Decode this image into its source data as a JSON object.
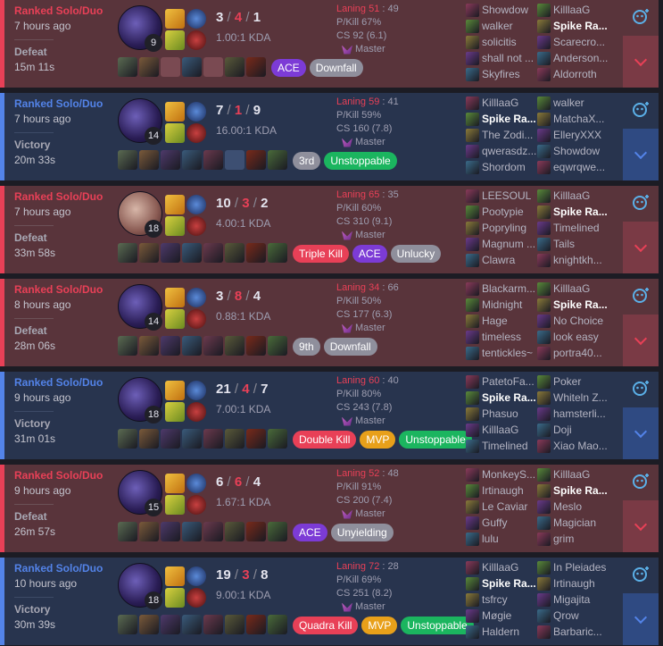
{
  "matches": [
    {
      "mode": "Ranked Solo/Duo",
      "ago": "7 hours ago",
      "result": "Defeat",
      "duration": "15m 11s",
      "outcome": "loss",
      "champ_level": "9",
      "champ_style": "kassadin",
      "k": "3",
      "d": "4",
      "a": "1",
      "kda_ratio": "1.00:1 KDA",
      "laning": "Laning 51",
      "laning_opp": "49",
      "pkill": "P/Kill 67%",
      "cs": "CS 92 (6.1)",
      "mastery": "Master",
      "items": [
        "filled",
        "filled",
        "empty",
        "filled",
        "empty",
        "filled",
        "filled"
      ],
      "badges": [
        {
          "label": "ACE",
          "color": "#7c3bd6"
        },
        {
          "label": "Downfall",
          "color": "#8f8f9c"
        }
      ],
      "team1": [
        "Showdow",
        "walker",
        "solicitis",
        "shall not ...",
        "Skyfires"
      ],
      "team2": [
        "KilllaaG",
        "Spike Ra...",
        "Scarecro...",
        "Anderson...",
        "Aldorroth"
      ],
      "me_team": 2,
      "me_index": 1
    },
    {
      "mode": "Ranked Solo/Duo",
      "ago": "7 hours ago",
      "result": "Victory",
      "duration": "20m 33s",
      "outcome": "win",
      "champ_level": "14",
      "champ_style": "kassadin",
      "k": "7",
      "d": "1",
      "a": "9",
      "kda_ratio": "16.00:1 KDA",
      "laning": "Laning 59",
      "laning_opp": "41",
      "pkill": "P/Kill 59%",
      "cs": "CS 160 (7.8)",
      "mastery": "Master",
      "items": [
        "filled",
        "filled",
        "filled",
        "filled",
        "filled",
        "empty",
        "filled",
        "filled"
      ],
      "badges": [
        {
          "label": "3rd",
          "color": "#8f8f9c"
        },
        {
          "label": "Unstoppable",
          "color": "#1bb55f"
        }
      ],
      "team1": [
        "KilllaaG",
        "Spike Ra...",
        "The Zodi...",
        "qwerasdz...",
        "Shordom"
      ],
      "team2": [
        "walker",
        "MatchaX...",
        "ElleryXXX",
        "Showdow",
        "eqwrqwe..."
      ],
      "me_team": 1,
      "me_index": 1
    },
    {
      "mode": "Ranked Solo/Duo",
      "ago": "7 hours ago",
      "result": "Defeat",
      "duration": "33m 58s",
      "outcome": "loss",
      "champ_level": "18",
      "champ_style": "alt",
      "k": "10",
      "d": "3",
      "a": "2",
      "kda_ratio": "4.00:1 KDA",
      "laning": "Laning 65",
      "laning_opp": "35",
      "pkill": "P/Kill 60%",
      "cs": "CS 310 (9.1)",
      "mastery": "Master",
      "items": [
        "filled",
        "filled",
        "filled",
        "filled",
        "filled",
        "filled",
        "filled",
        "filled"
      ],
      "badges": [
        {
          "label": "Triple Kill",
          "color": "#e84057"
        },
        {
          "label": "ACE",
          "color": "#7c3bd6"
        },
        {
          "label": "Unlucky",
          "color": "#8f8f9c"
        }
      ],
      "team1": [
        "LEESOUL",
        "Pootypie",
        "Popryling",
        "Magnum ...",
        "Clawra"
      ],
      "team2": [
        "KilllaaG",
        "Spike Ra...",
        "Timelined",
        "Tails",
        "knightkh..."
      ],
      "me_team": 2,
      "me_index": 1
    },
    {
      "mode": "Ranked Solo/Duo",
      "ago": "8 hours ago",
      "result": "Defeat",
      "duration": "28m 06s",
      "outcome": "loss",
      "champ_level": "14",
      "champ_style": "kassadin",
      "k": "3",
      "d": "8",
      "a": "4",
      "kda_ratio": "0.88:1 KDA",
      "laning": "Laning 34",
      "laning_opp": "66",
      "pkill": "P/Kill 50%",
      "cs": "CS 177 (6.3)",
      "mastery": "Master",
      "items": [
        "filled",
        "filled",
        "filled",
        "filled",
        "filled",
        "filled",
        "filled",
        "filled"
      ],
      "badges": [
        {
          "label": "9th",
          "color": "#8f8f9c"
        },
        {
          "label": "Downfall",
          "color": "#8f8f9c"
        }
      ],
      "team1": [
        "Blackarm...",
        "Midnight",
        "Hage",
        "timeless",
        "tentickles~"
      ],
      "team2": [
        "KilllaaG",
        "Spike Ra...",
        "No Choice",
        "look easy",
        "portra40..."
      ],
      "me_team": 2,
      "me_index": 1
    },
    {
      "mode": "Ranked Solo/Duo",
      "ago": "9 hours ago",
      "result": "Victory",
      "duration": "31m 01s",
      "outcome": "win",
      "champ_level": "18",
      "champ_style": "kassadin",
      "k": "21",
      "d": "4",
      "a": "7",
      "kda_ratio": "7.00:1 KDA",
      "laning": "Laning 60",
      "laning_opp": "40",
      "pkill": "P/Kill 80%",
      "cs": "CS 243 (7.8)",
      "mastery": "Master",
      "items": [
        "filled",
        "filled",
        "filled",
        "filled",
        "filled",
        "filled",
        "filled",
        "filled"
      ],
      "badges": [
        {
          "label": "Double Kill",
          "color": "#e84057"
        },
        {
          "label": "MVP",
          "color": "#e8a01a"
        },
        {
          "label": "Unstoppable",
          "color": "#1bb55f"
        }
      ],
      "team1": [
        "PatetoFa...",
        "Spike Ra...",
        "Phasuo",
        "KilllaaG",
        "Timelined"
      ],
      "team2": [
        "Poker",
        "Whiteln Z...",
        "hamsterli...",
        "Doji",
        "Xiao Mao..."
      ],
      "me_team": 1,
      "me_index": 1
    },
    {
      "mode": "Ranked Solo/Duo",
      "ago": "9 hours ago",
      "result": "Defeat",
      "duration": "26m 57s",
      "outcome": "loss",
      "champ_level": "15",
      "champ_style": "kassadin",
      "k": "6",
      "d": "6",
      "a": "4",
      "kda_ratio": "1.67:1 KDA",
      "laning": "Laning 52",
      "laning_opp": "48",
      "pkill": "P/Kill 91%",
      "cs": "CS 200 (7.4)",
      "mastery": "Master",
      "items": [
        "filled",
        "filled",
        "filled",
        "filled",
        "filled",
        "filled",
        "filled",
        "filled"
      ],
      "badges": [
        {
          "label": "ACE",
          "color": "#7c3bd6"
        },
        {
          "label": "Unyielding",
          "color": "#8f8f9c"
        }
      ],
      "team1": [
        "MonkeyS...",
        "Irtinaugh",
        "Le Caviar",
        "Guffy",
        "lulu"
      ],
      "team2": [
        "KilllaaG",
        "Spike Ra...",
        "Meslo",
        "Magician",
        "grim"
      ],
      "me_team": 2,
      "me_index": 1
    },
    {
      "mode": "Ranked Solo/Duo",
      "ago": "10 hours ago",
      "result": "Victory",
      "duration": "30m 39s",
      "outcome": "win",
      "champ_level": "18",
      "champ_style": "kassadin",
      "k": "19",
      "d": "3",
      "a": "8",
      "kda_ratio": "9.00:1 KDA",
      "laning": "Laning 72",
      "laning_opp": "28",
      "pkill": "P/Kill 69%",
      "cs": "CS 251 (8.2)",
      "mastery": "Master",
      "items": [
        "filled",
        "filled",
        "filled",
        "filled",
        "filled",
        "filled",
        "filled",
        "filled"
      ],
      "badges": [
        {
          "label": "Quadra Kill",
          "color": "#e84057"
        },
        {
          "label": "MVP",
          "color": "#e8a01a"
        },
        {
          "label": "Unstoppable",
          "color": "#1bb55f"
        }
      ],
      "team1": [
        "KilllaaG",
        "Spike Ra...",
        "tsfrcy",
        "Møgie",
        "Haldern"
      ],
      "team2": [
        "In Pleiades",
        "Irtinaugh",
        "Migajita",
        "Qrow",
        "Barbaric..."
      ],
      "me_team": 1,
      "me_index": 1
    }
  ],
  "icons": {
    "share": "share-icon",
    "expand": "chevron-down-icon",
    "mastery": "master-rank-icon"
  }
}
